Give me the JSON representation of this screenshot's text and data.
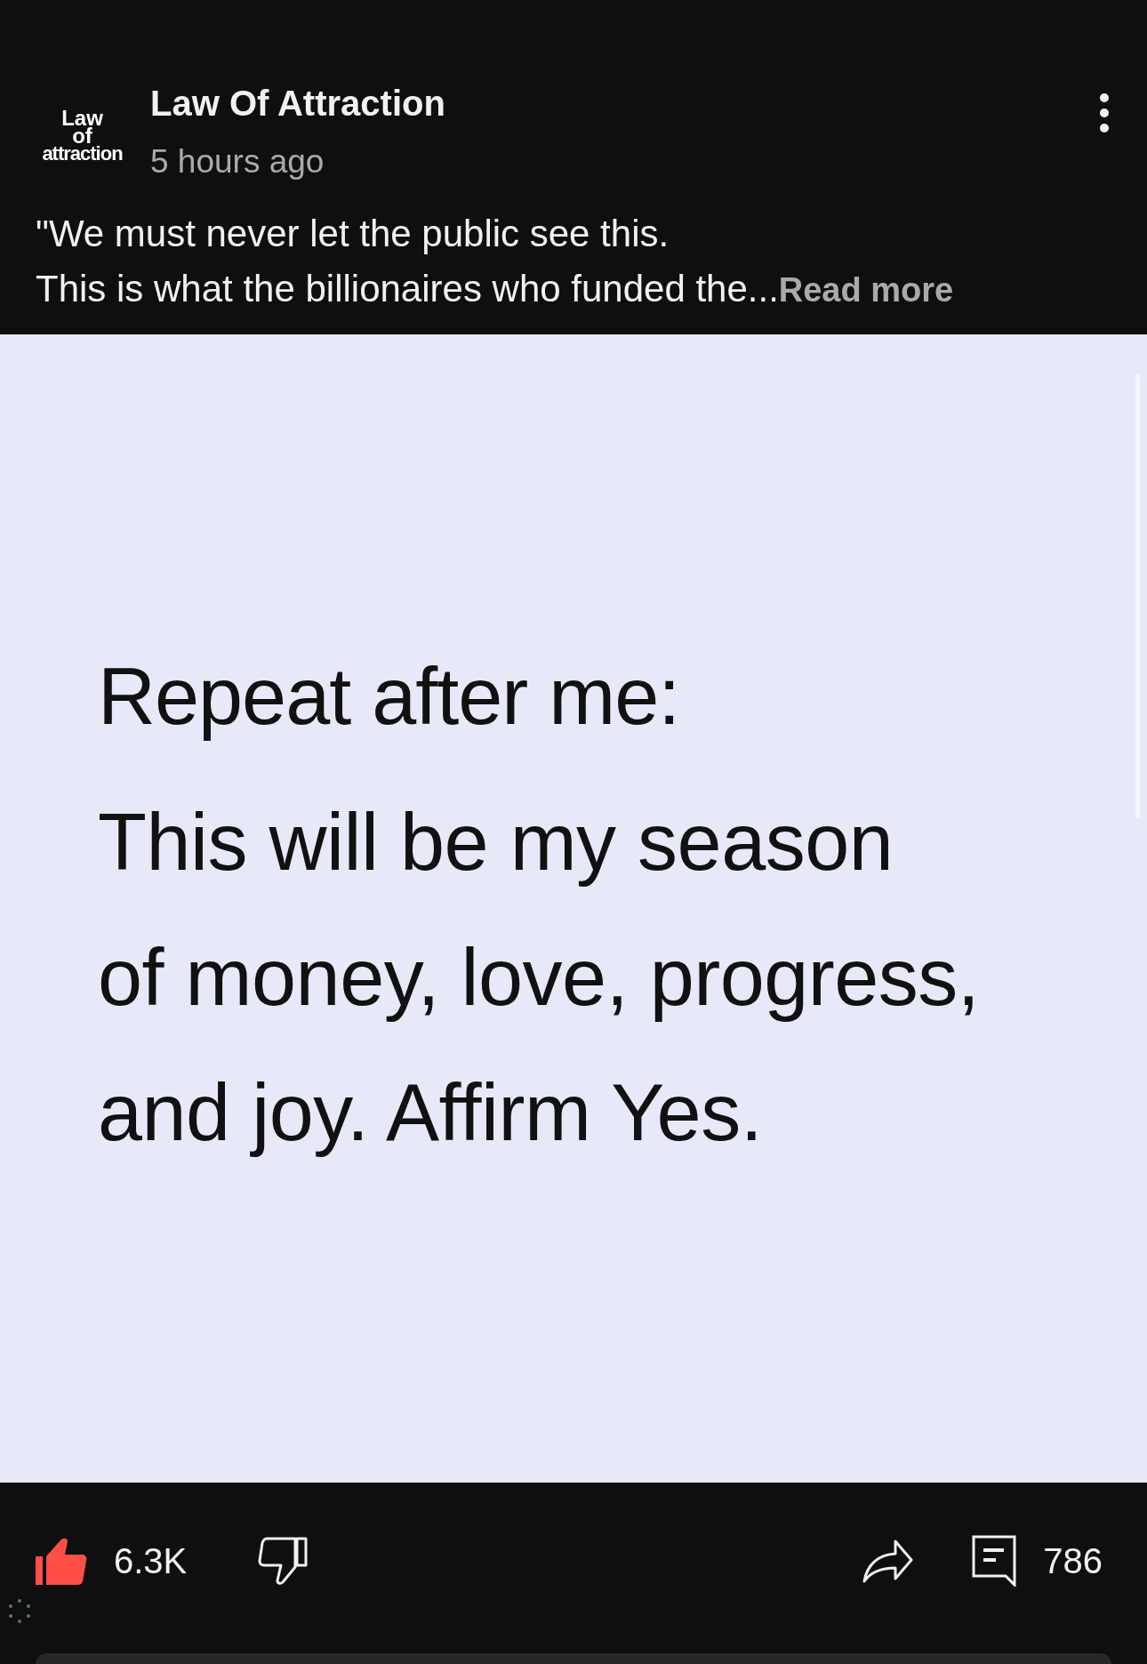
{
  "post": {
    "avatar_logo": [
      "Law",
      "of",
      "attraction"
    ],
    "channel": "Law Of Attraction",
    "time": "5 hours ago",
    "text_lines": [
      "\"We must never let the public see this.",
      "This is what the billionaires who funded the..."
    ],
    "read_more": "Read more",
    "image_text": {
      "heading": "Repeat after me:",
      "lines": [
        "This will be my season",
        "of money, love, progress,",
        "and joy. Affirm Yes."
      ]
    }
  },
  "actions": {
    "like": {
      "count": "6.3K",
      "selected": true
    },
    "dislike": {
      "selected": false
    },
    "comments": {
      "count": "786"
    }
  }
}
